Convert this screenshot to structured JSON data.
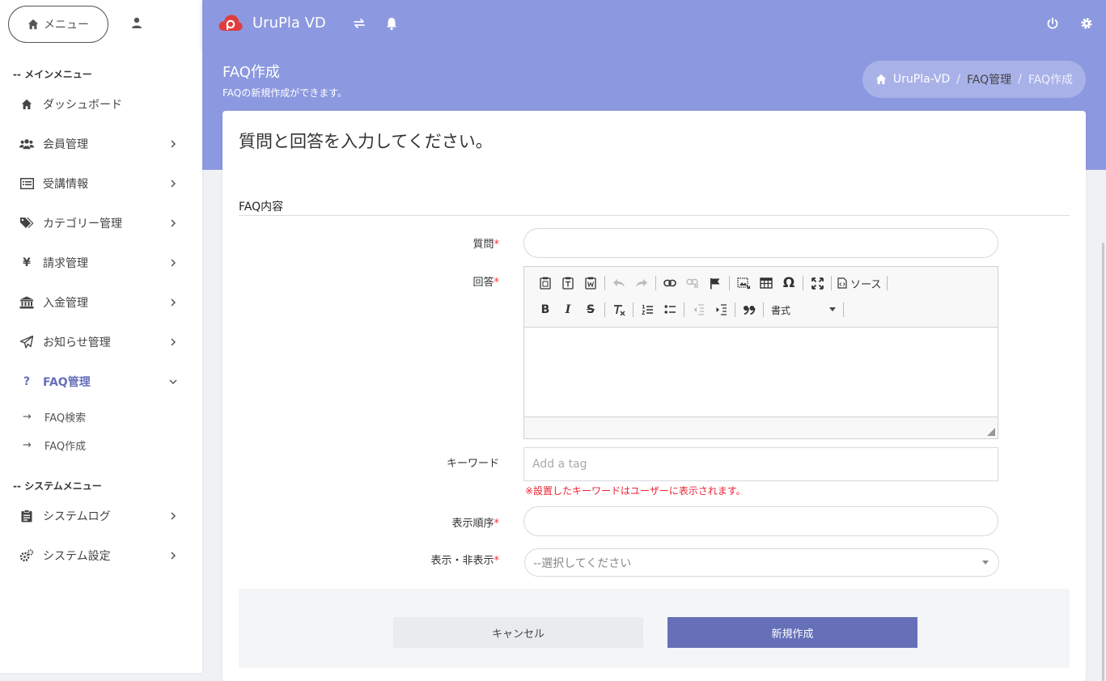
{
  "sidebar": {
    "menu_label": "メニュー",
    "main_section": "-- メインメニュー",
    "items": [
      {
        "label": "ダッシュボード",
        "icon": "home-icon"
      },
      {
        "label": "会員管理",
        "icon": "users-icon"
      },
      {
        "label": "受講情報",
        "icon": "list-icon"
      },
      {
        "label": "カテゴリー管理",
        "icon": "tags-icon"
      },
      {
        "label": "請求管理",
        "icon": "yen-icon"
      },
      {
        "label": "入金管理",
        "icon": "bank-icon"
      },
      {
        "label": "お知らせ管理",
        "icon": "paper-plane-icon"
      },
      {
        "label": "FAQ管理",
        "icon": "question-icon"
      }
    ],
    "faq_sub": [
      {
        "arrow": "→",
        "label": "FAQ検索"
      },
      {
        "arrow": "→",
        "label": "FAQ作成"
      }
    ],
    "system_section": "-- システムメニュー",
    "system_items": [
      {
        "label": "システムログ",
        "icon": "clipboard-icon"
      },
      {
        "label": "システム設定",
        "icon": "cogs-icon"
      }
    ]
  },
  "header": {
    "app_name": "UruPla VD"
  },
  "page": {
    "title": "FAQ作成",
    "subtitle": "FAQの新規作成ができます。",
    "breadcrumb": [
      "UruPla-VD",
      "/",
      "FAQ管理",
      "/",
      "FAQ作成"
    ]
  },
  "form": {
    "heading": "質問と回答を入力してください。",
    "fieldset_title": "FAQ内容",
    "question_label": "質問",
    "answer_label": "回答",
    "required_mark": "*",
    "source_label": "ソース",
    "format_label": "書式",
    "keyword_label": "キーワード",
    "keyword_placeholder": "Add a tag",
    "keyword_hint": "※設置したキーワードはユーザーに表示されます。",
    "order_label": "表示順序",
    "visibility_label": "表示・非表示",
    "visibility_value": "--選択してください",
    "cancel_label": "キャンセル",
    "submit_label": "新規作成"
  },
  "colors": {
    "header_bg": "#8c98df",
    "accent": "#6670b8",
    "required": "#e33333"
  }
}
